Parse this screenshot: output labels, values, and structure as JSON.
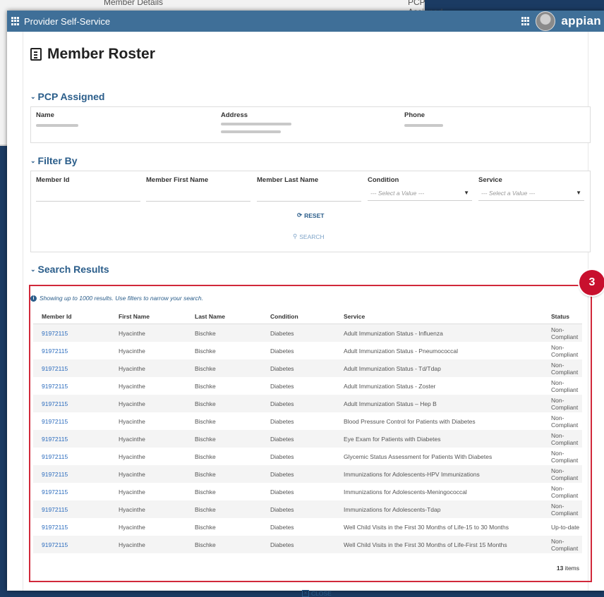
{
  "background": {
    "left_label": "Member Details",
    "right_label": "PCP Assigned"
  },
  "appbar": {
    "title": "Provider Self-Service",
    "brand": "appian"
  },
  "page": {
    "title": "Member Roster"
  },
  "pcp": {
    "heading": "PCP Assigned",
    "col_name": "Name",
    "col_address": "Address",
    "col_phone": "Phone"
  },
  "filter": {
    "heading": "Filter By",
    "labels": {
      "member_id": "Member Id",
      "first_name": "Member First Name",
      "last_name": "Member Last Name",
      "condition": "Condition",
      "service": "Service"
    },
    "condition_placeholder": "--- Select a Value ---",
    "service_placeholder": "--- Select a Value ---",
    "reset_label": "RESET",
    "search_label": "SEARCH"
  },
  "results": {
    "heading": "Search Results",
    "badge": "3",
    "info": "Showing up to 1000 results. Use filters to narrow your search.",
    "columns": [
      "Member Id",
      "First Name",
      "Last Name",
      "Condition",
      "Service",
      "Status"
    ],
    "rows": [
      [
        "91972115",
        "Hyacinthe",
        "Bischke",
        "Diabetes",
        "Adult Immunization Status - Influenza",
        "Non-Compliant"
      ],
      [
        "91972115",
        "Hyacinthe",
        "Bischke",
        "Diabetes",
        "Adult Immunization Status - Pneumococcal",
        "Non-Compliant"
      ],
      [
        "91972115",
        "Hyacinthe",
        "Bischke",
        "Diabetes",
        "Adult Immunization Status - Td/Tdap",
        "Non-Compliant"
      ],
      [
        "91972115",
        "Hyacinthe",
        "Bischke",
        "Diabetes",
        "Adult Immunization Status - Zoster",
        "Non-Compliant"
      ],
      [
        "91972115",
        "Hyacinthe",
        "Bischke",
        "Diabetes",
        "Adult Immunization Status – Hep B",
        "Non-Compliant"
      ],
      [
        "91972115",
        "Hyacinthe",
        "Bischke",
        "Diabetes",
        "Blood Pressure Control for Patients with Diabetes",
        "Non-Compliant"
      ],
      [
        "91972115",
        "Hyacinthe",
        "Bischke",
        "Diabetes",
        "Eye Exam for Patients with Diabetes",
        "Non-Compliant"
      ],
      [
        "91972115",
        "Hyacinthe",
        "Bischke",
        "Diabetes",
        "Glycemic Status Assessment for Patients With Diabetes",
        "Non-Compliant"
      ],
      [
        "91972115",
        "Hyacinthe",
        "Bischke",
        "Diabetes",
        "Immunizations for Adolescents-HPV Immunizations",
        "Non-Compliant"
      ],
      [
        "91972115",
        "Hyacinthe",
        "Bischke",
        "Diabetes",
        "Immunizations for Adolescents-Meningococcal",
        "Non-Compliant"
      ],
      [
        "91972115",
        "Hyacinthe",
        "Bischke",
        "Diabetes",
        "Immunizations for Adolescents-Tdap",
        "Non-Compliant"
      ],
      [
        "91972115",
        "Hyacinthe",
        "Bischke",
        "Diabetes",
        "Well Child Visits in the First 30 Months of Life-15 to 30 Months",
        "Up-to-date"
      ],
      [
        "91972115",
        "Hyacinthe",
        "Bischke",
        "Diabetes",
        "Well Child Visits in the First 30 Months of Life-First 15 Months",
        "Non-Compliant"
      ]
    ],
    "item_count": "13",
    "item_suffix": "items"
  },
  "footer": {
    "close_label": "CLOSE"
  },
  "colors": {
    "accent": "#2a5d8a",
    "highlight": "#d1283a",
    "appbar": "#3f6f98"
  }
}
